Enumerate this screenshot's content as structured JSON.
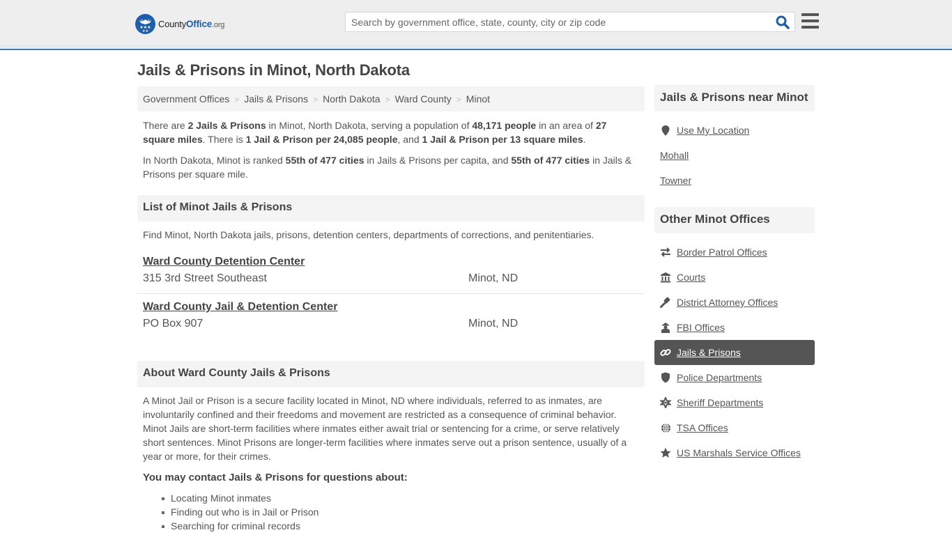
{
  "header": {
    "logo_main": "County",
    "logo_brand": "Office",
    "logo_tld": ".org",
    "search_placeholder": "Search by government office, state, county, city or zip code",
    "search_value": "",
    "accent_color": "#1f5ea8"
  },
  "page": {
    "title": "Jails & Prisons in Minot, North Dakota"
  },
  "breadcrumb": [
    "Government Offices",
    "Jails & Prisons",
    "North Dakota",
    "Ward County",
    "Minot"
  ],
  "intro": {
    "p1": {
      "t1": "There are ",
      "b1": "2 Jails & Prisons",
      "t2": " in Minot, North Dakota, serving a population of ",
      "b2": "48,171 people",
      "t3": " in an area of ",
      "b3": "27 square miles",
      "t4": ". There is ",
      "b4": "1 Jail & Prison per 24,085 people",
      "t5": ", and ",
      "b5": "1 Jail & Prison per 13 square miles",
      "t6": "."
    },
    "p2": {
      "t1": "In North Dakota, Minot is ranked ",
      "b1": "55th of 477 cities",
      "t2": " in Jails & Prisons per capita, and ",
      "b2": "55th of 477 cities",
      "t3": " in Jails & Prisons per square mile."
    }
  },
  "list_section": {
    "title": "List of Minot Jails & Prisons",
    "description": "Find Minot, North Dakota jails, prisons, detention centers, departments of corrections, and penitentiaries.",
    "items": [
      {
        "name": "Ward County Detention Center",
        "address": "315 3rd Street Southeast",
        "city": "Minot, ND"
      },
      {
        "name": "Ward County Jail & Detention Center",
        "address": "PO Box 907",
        "city": "Minot, ND"
      }
    ]
  },
  "about_section": {
    "title": "About Ward County Jails & Prisons",
    "body": "A Minot Jail or Prison is a secure facility located in Minot, ND where individuals, referred to as inmates, are involuntarily confined and their freedoms and movement are restricted as a consequence of criminal behavior. Minot Jails are short-term facilities where inmates either await trial or sentencing for a crime, or serve relatively short sentences. Minot Prisons are longer-term facilities where inmates serve out a prison sentence, usually of a year or more, for their crimes.",
    "contact_title": "You may contact Jails & Prisons for questions about:",
    "contact_items": [
      "Locating Minot inmates",
      "Finding out who is in Jail or Prison",
      "Searching for criminal records"
    ]
  },
  "sidebar": {
    "nearby": {
      "title": "Jails & Prisons near Minot",
      "use_location": {
        "label": "Use My Location",
        "icon": "map-marker-icon"
      },
      "cities": [
        "Mohall",
        "Towner"
      ]
    },
    "other": {
      "title": "Other Minot Offices",
      "items": [
        {
          "label": "Border Patrol Offices",
          "icon": "exchange-icon",
          "active": false
        },
        {
          "label": "Courts",
          "icon": "courthouse-icon",
          "active": false
        },
        {
          "label": "District Attorney Offices",
          "icon": "gavel-icon",
          "active": false
        },
        {
          "label": "FBI Offices",
          "icon": "agent-icon",
          "active": false
        },
        {
          "label": "Jails & Prisons",
          "icon": "link-icon",
          "active": true
        },
        {
          "label": "Police Departments",
          "icon": "shield-icon",
          "active": false
        },
        {
          "label": "Sheriff Departments",
          "icon": "sheriff-star-icon",
          "active": false
        },
        {
          "label": "TSA Offices",
          "icon": "globe-icon",
          "active": false
        },
        {
          "label": "US Marshals Service Offices",
          "icon": "star-icon",
          "active": false
        }
      ]
    }
  }
}
